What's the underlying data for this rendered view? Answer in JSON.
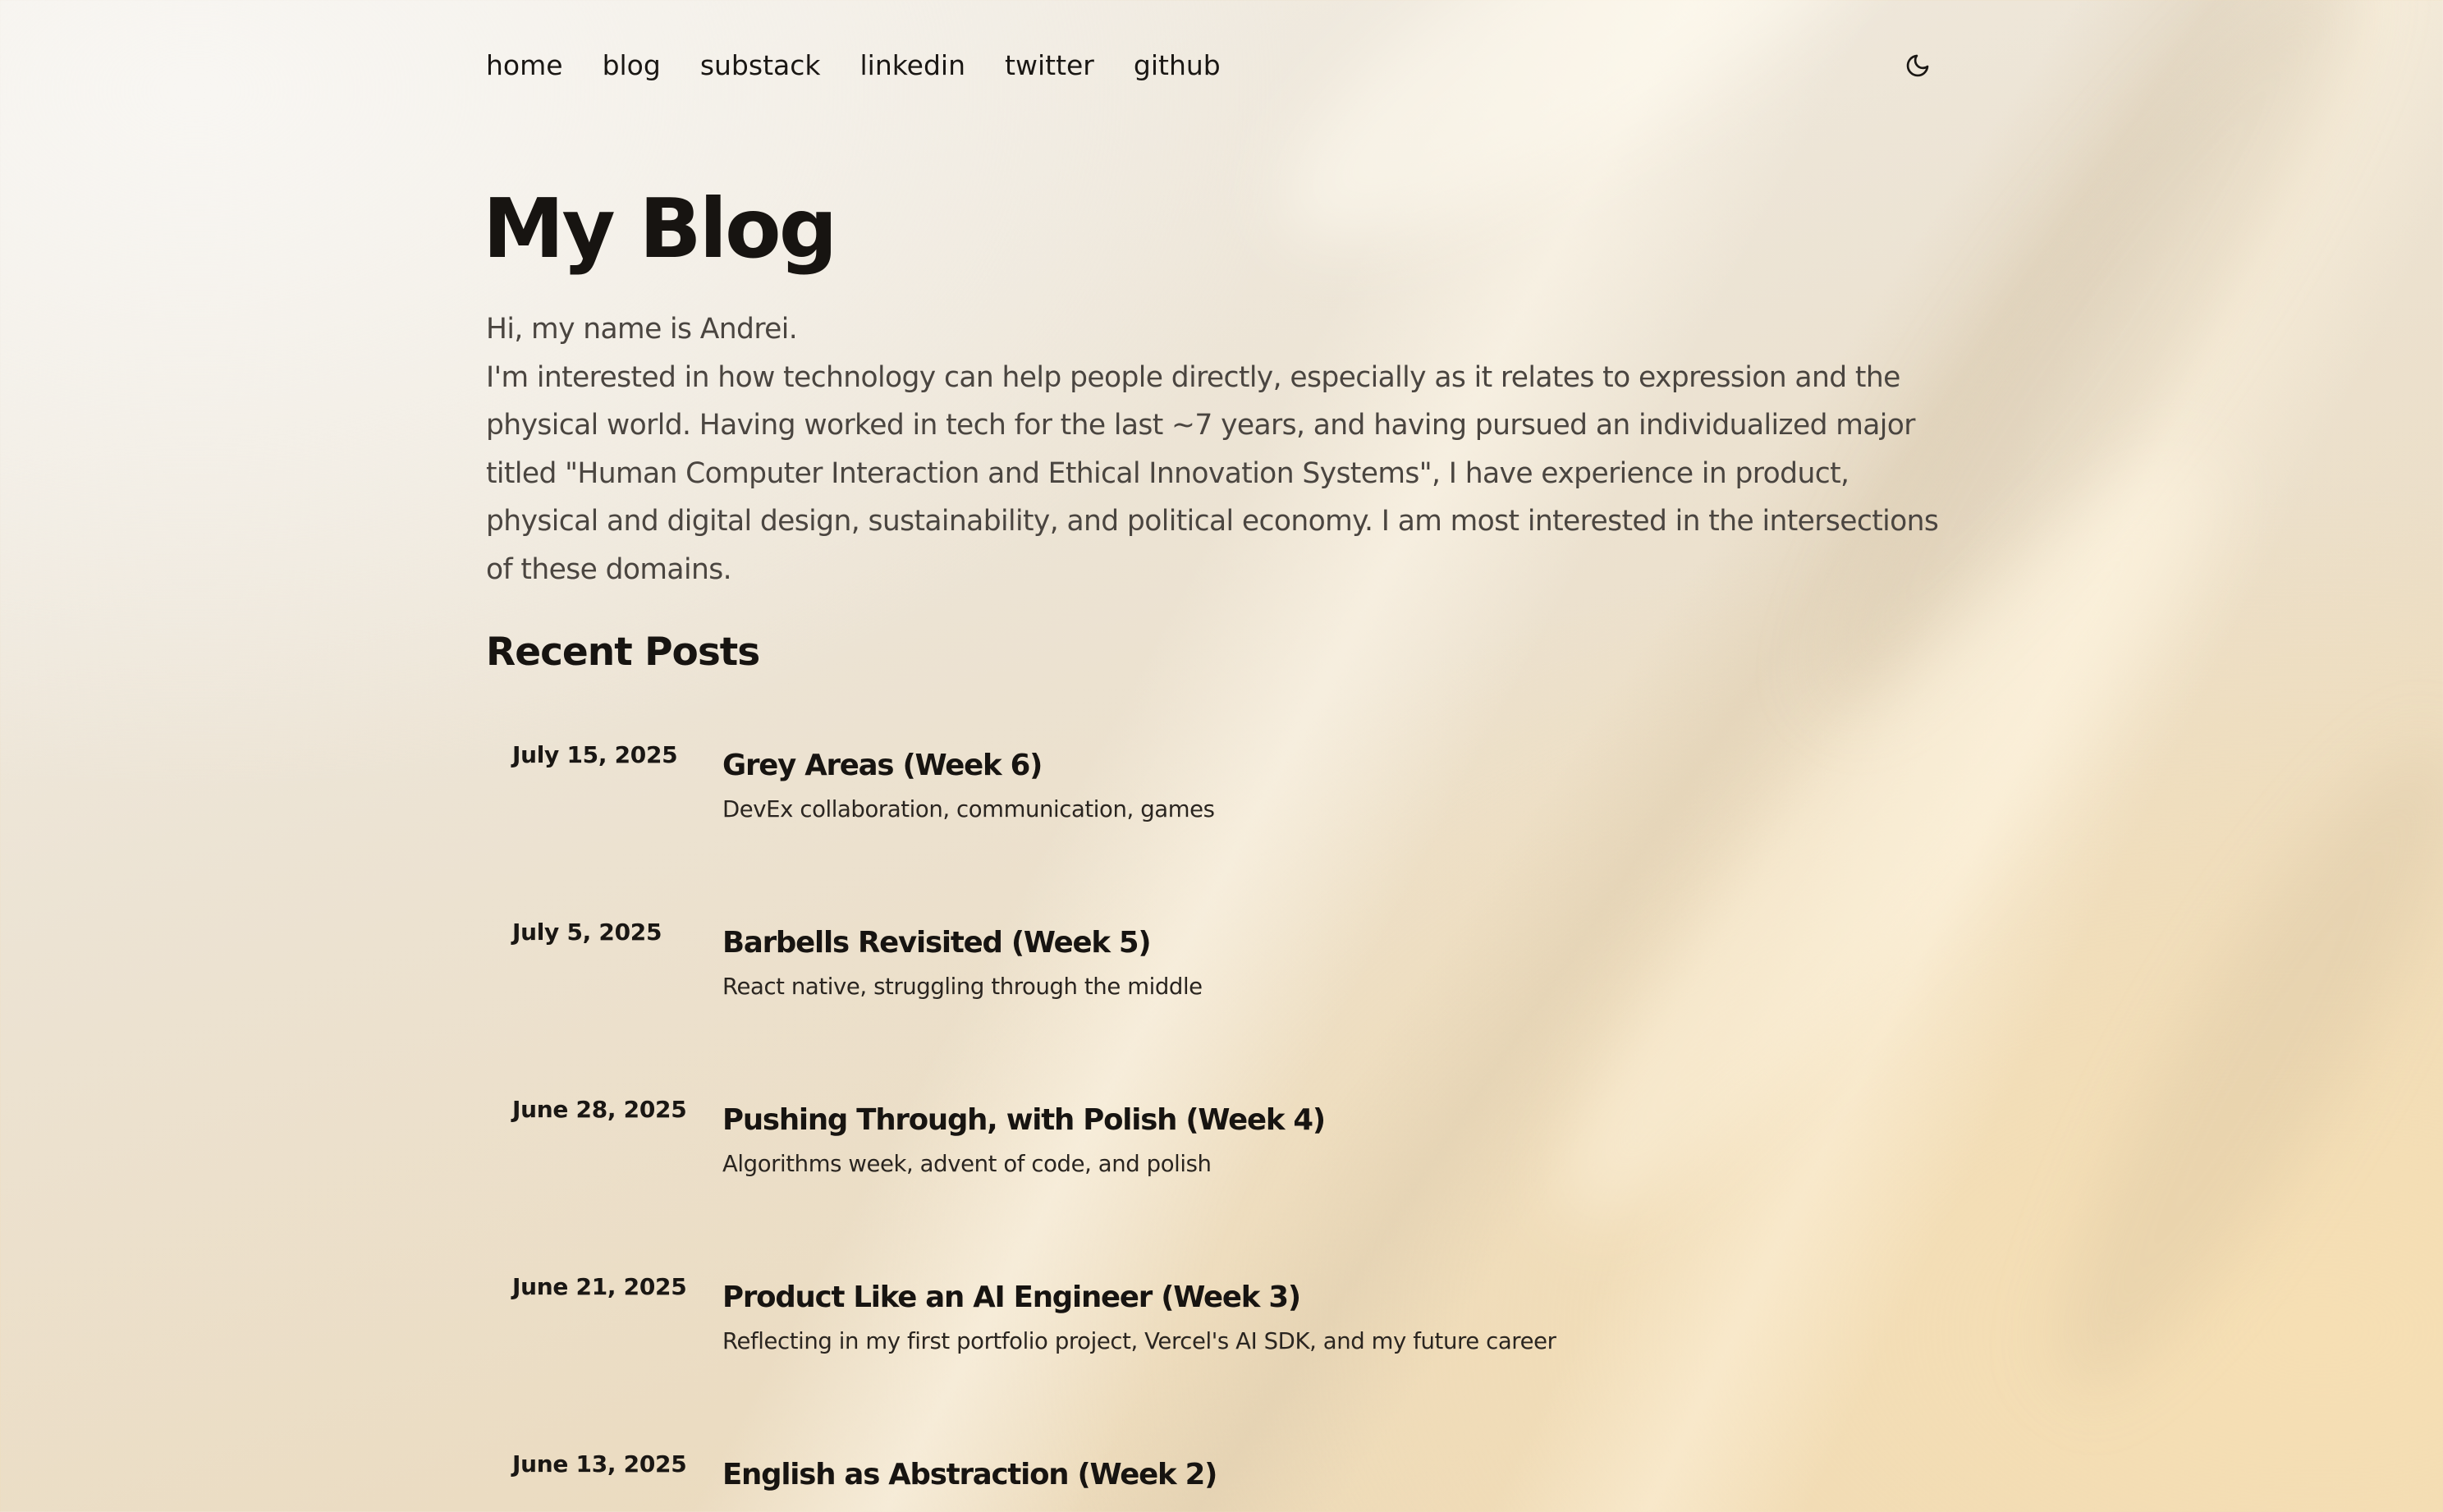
{
  "nav": {
    "links": [
      "home",
      "blog",
      "substack",
      "linkedin",
      "twitter",
      "github"
    ],
    "theme_icon": "moon-icon"
  },
  "hero": {
    "title": "My Blog",
    "intro_line1": "Hi, my name is Andrei.",
    "intro_line2": "I'm interested in how technology can help people directly, especially as it relates to expression and the physical world. Having worked in tech for the last ~7 years, and having pursued an individualized major titled \"Human Computer Interaction and Ethical Innovation Systems\", I have experience in product, physical and digital design, sustainability, and political economy. I am most interested in the intersections of these domains."
  },
  "recent": {
    "heading": "Recent Posts",
    "posts": [
      {
        "date": "July 15, 2025",
        "title": "Grey Areas (Week 6)",
        "desc": "DevEx collaboration, communication, games"
      },
      {
        "date": "July 5, 2025",
        "title": "Barbells Revisited (Week 5)",
        "desc": "React native, struggling through the middle"
      },
      {
        "date": "June 28, 2025",
        "title": "Pushing Through, with Polish (Week 4)",
        "desc": "Algorithms week, advent of code, and polish"
      },
      {
        "date": "June 21, 2025",
        "title": "Product Like an AI Engineer (Week 3)",
        "desc": "Reflecting in my first portfolio project, Vercel's AI SDK, and my future career"
      },
      {
        "date": "June 13, 2025",
        "title": "English as Abstraction (Week 2)",
        "desc": ""
      }
    ]
  },
  "colors": {
    "text": "#1a1714",
    "muted_text": "#4a4540",
    "background_light": "#f3f0ea",
    "background_warm": "#ecd6b0"
  }
}
